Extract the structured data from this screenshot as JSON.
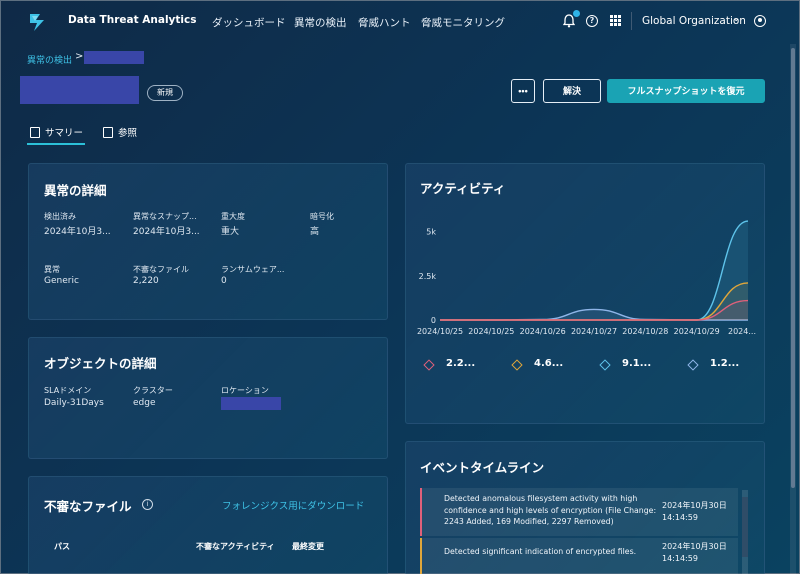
{
  "app": {
    "title": "Data Threat Analytics"
  },
  "nav": {
    "items": [
      "ダッシュボード",
      "異常の検出",
      "脅威ハント",
      "脅威モニタリング"
    ],
    "organization": "Global Organization"
  },
  "breadcrumb": {
    "parent": "異常の検出",
    "separator": ">"
  },
  "header": {
    "badge": "新規",
    "more_label": "•••",
    "resolve_label": "解決",
    "restore_label": "フルスナップショットを復元"
  },
  "tabs": [
    "サマリー",
    "参照"
  ],
  "anomaly_details": {
    "title": "異常の詳細",
    "fields": [
      {
        "label": "検出済み",
        "value": "2024年10月3..."
      },
      {
        "label": "異常なスナップ...",
        "value": "2024年10月3..."
      },
      {
        "label": "重大度",
        "value": "重大"
      },
      {
        "label": "暗号化",
        "value": "高"
      },
      {
        "label": "異常",
        "value": "Generic"
      },
      {
        "label": "不審なファイル",
        "value": "2,220"
      },
      {
        "label": "ランサムウェア...",
        "value": "0"
      }
    ]
  },
  "object_details": {
    "title": "オブジェクトの詳細",
    "fields": [
      {
        "label": "SLAドメイン",
        "value": "Daily-31Days"
      },
      {
        "label": "クラスター",
        "value": "edge"
      },
      {
        "label": "ロケーション",
        "value": ""
      }
    ]
  },
  "suspicious_files": {
    "title": "不審なファイル",
    "download_label": "フォレンジクス用にダウンロード",
    "columns": [
      "パス",
      "不審なアクティビティ",
      "最終変更"
    ]
  },
  "activity": {
    "title": "アクティビティ",
    "legend": [
      {
        "value": "2.2...",
        "color": "#e0607a"
      },
      {
        "value": "4.6...",
        "color": "#e0a63a"
      },
      {
        "value": "9.1...",
        "color": "#5ec3ea"
      },
      {
        "value": "1.2...",
        "color": "#8fb5e8"
      }
    ]
  },
  "chart_data": {
    "type": "area",
    "title": "アクティビティ",
    "x": [
      "2024/10/25",
      "2024/10/25",
      "2024/10/26",
      "2024/10/27",
      "2024/10/28",
      "2024/10/29",
      "2024..."
    ],
    "ytick_labels": [
      "0",
      "2.5k",
      "5k"
    ],
    "ylim": [
      0,
      6000
    ],
    "series": [
      {
        "color": "#5ec3ea",
        "values": [
          0,
          0,
          0,
          0,
          0,
          0,
          5600
        ]
      },
      {
        "color": "#8fb5e8",
        "values": [
          0,
          0,
          30,
          600,
          30,
          0,
          0
        ]
      },
      {
        "color": "#e0a63a",
        "values": [
          0,
          0,
          0,
          0,
          0,
          0,
          2100
        ]
      },
      {
        "color": "#e0607a",
        "values": [
          0,
          0,
          0,
          0,
          0,
          0,
          1100
        ]
      }
    ]
  },
  "timeline": {
    "title": "イベントタイムライン",
    "events": [
      {
        "text": "Detected anomalous filesystem activity with high confidence and high levels of encryption (File Change: 2243 Added, 169 Modified, 2297 Removed)",
        "date": "2024年10月30日",
        "time": "14:14:59",
        "color": "#e0607a"
      },
      {
        "text": "Detected significant indication of encrypted files.",
        "date": "2024年10月30日",
        "time": "14:14:59",
        "color": "#e0a63a"
      }
    ]
  }
}
